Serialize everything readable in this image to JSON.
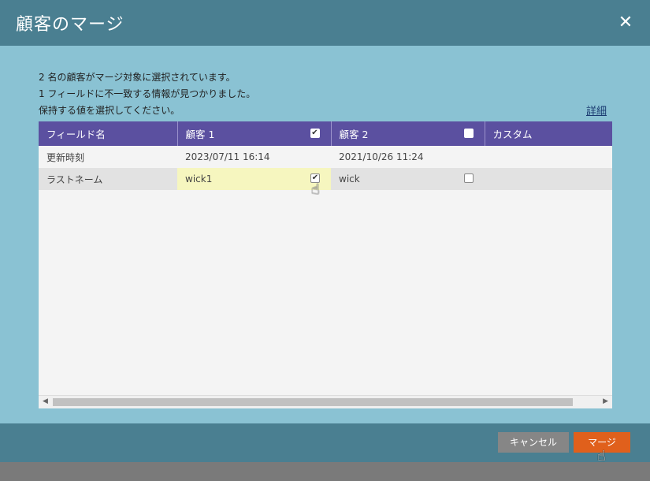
{
  "dialog": {
    "title": "顧客のマージ",
    "close_icon": "close-icon"
  },
  "messages": [
    "2 名の顧客がマージ対象に選択されています。",
    "1 フィールドに不一致する情報が見つかりました。",
    "保持する値を選択してください。"
  ],
  "details_link": "詳細",
  "table": {
    "headers": [
      "フィールド名",
      "顧客 1",
      "顧客 2",
      "カスタム"
    ],
    "header_checked": [
      true,
      false
    ],
    "rows": [
      {
        "field": "更新時刻",
        "customer1": "2023/07/11 16:14",
        "customer2": "2021/10/26 11:24",
        "custom": ""
      },
      {
        "field": "ラストネーム",
        "customer1": "wick1",
        "customer2": "wick",
        "custom": "",
        "customer1_checked": true,
        "customer2_checked": false
      }
    ]
  },
  "buttons": {
    "cancel": "キャンセル",
    "merge": "マージ"
  },
  "colors": {
    "title_bar": "#4a7f91",
    "body": "#8ac2d3",
    "header": "#5b50a0",
    "merge_button": "#e0601c",
    "cancel_button": "#868686",
    "selected_cell": "#f6f6bf"
  }
}
